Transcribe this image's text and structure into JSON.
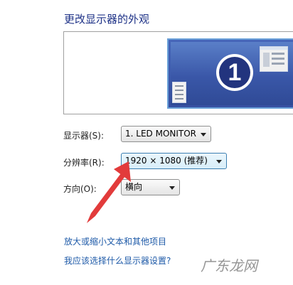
{
  "heading": "更改显示器的外观",
  "preview": {
    "monitor_number": "1"
  },
  "display": {
    "label": "显示器(S):",
    "value": "1. LED MONITOR"
  },
  "resolution": {
    "label": "分辨率(R):",
    "value": "1920 × 1080 (推荐)"
  },
  "orientation": {
    "label": "方向(O):",
    "value": "横向"
  },
  "links": {
    "enlarge_text": "放大或缩小文本和其他项目",
    "which_settings": "我应该选择什么显示器设置?"
  },
  "watermark": "广东龙网",
  "colors": {
    "heading": "#1e3287",
    "link": "#1e5aa8",
    "arrow": "#e23b3b",
    "monitor": "#3650a1"
  }
}
